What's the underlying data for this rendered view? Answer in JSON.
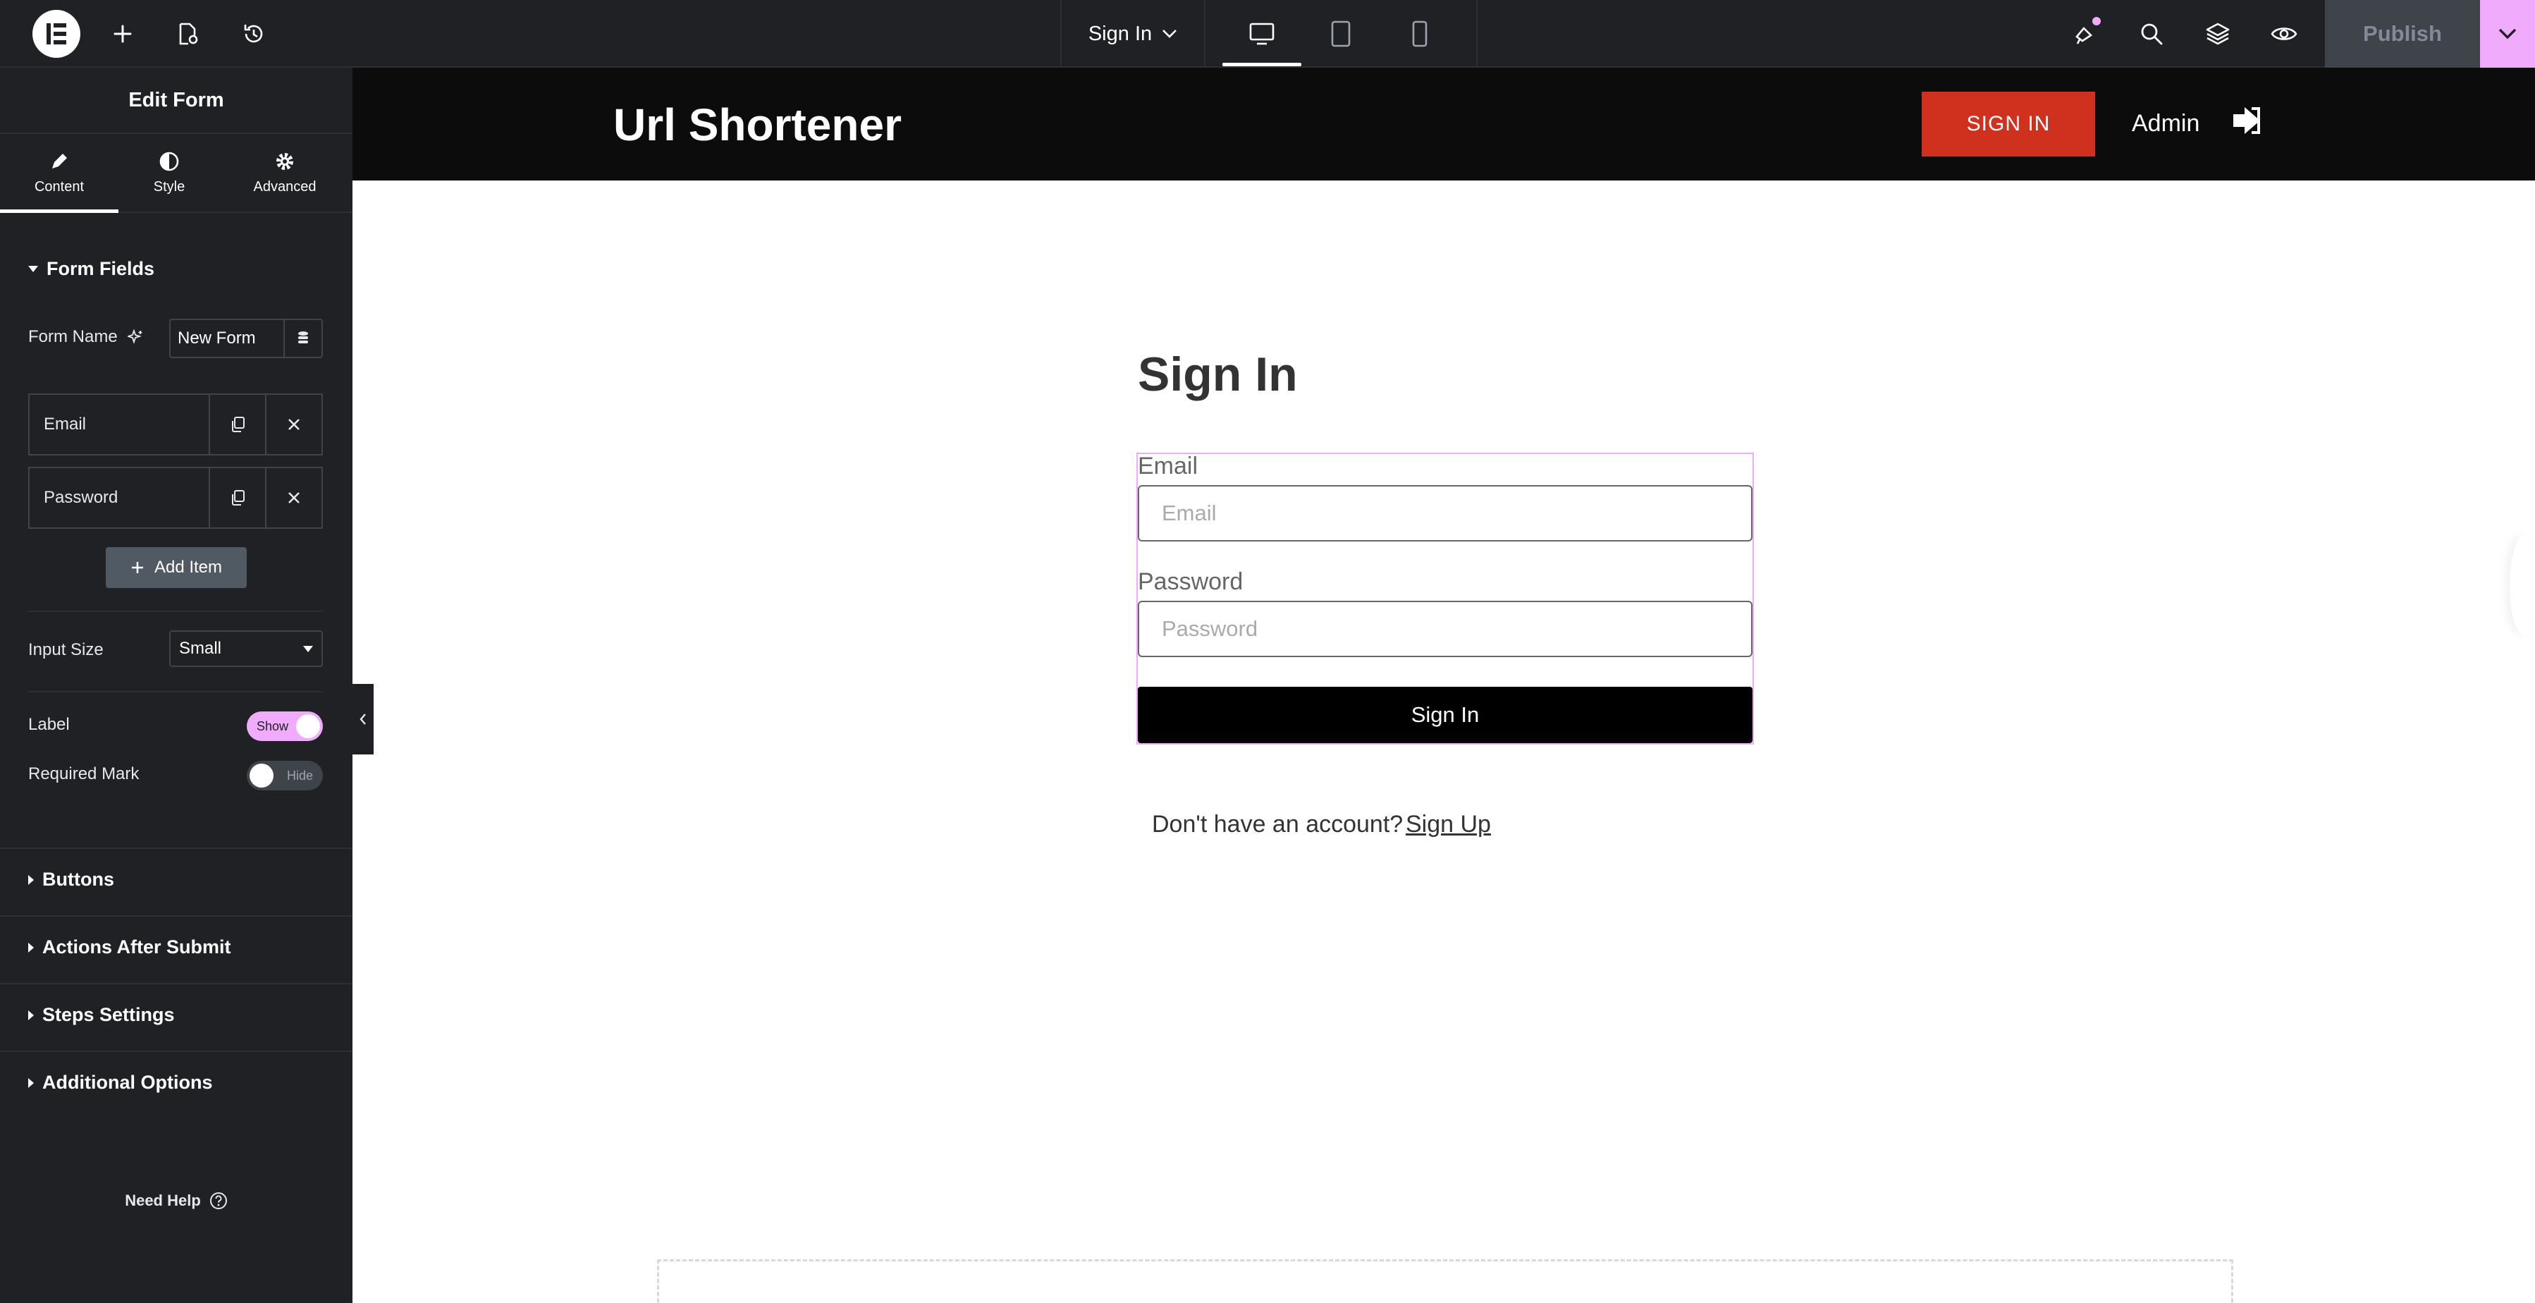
{
  "topbar": {
    "page_name": "Sign In",
    "publish_label": "Publish"
  },
  "panel": {
    "title": "Edit Form",
    "tabs": [
      {
        "label": "Content"
      },
      {
        "label": "Style"
      },
      {
        "label": "Advanced"
      }
    ],
    "form_fields": {
      "title": "Form Fields",
      "form_name_label": "Form Name",
      "form_name_value": "New Form",
      "items": [
        {
          "label": "Email"
        },
        {
          "label": "Password"
        }
      ],
      "add_item_label": "Add Item",
      "input_size_label": "Input Size",
      "input_size_value": "Small",
      "label_label": "Label",
      "label_toggle": "Show",
      "required_label": "Required Mark",
      "required_toggle": "Hide"
    },
    "sections": [
      {
        "label": "Buttons"
      },
      {
        "label": "Actions After Submit"
      },
      {
        "label": "Steps Settings"
      },
      {
        "label": "Additional Options"
      }
    ],
    "need_help": "Need Help"
  },
  "site": {
    "title": "Url Shortener",
    "signin_button": "SIGN IN",
    "admin_label": "Admin",
    "heading": "Sign In",
    "form": {
      "email_label": "Email",
      "email_placeholder": "Email",
      "password_label": "Password",
      "password_placeholder": "Password",
      "submit_label": "Sign In"
    },
    "no_account_text": "Don't have an account?",
    "signup_link": "Sign Up"
  },
  "colors": {
    "accent": "#f0abfc",
    "panel_bg": "#1f2124",
    "site_header_bg": "#0c0c0c",
    "signin_red": "#d0311f"
  }
}
